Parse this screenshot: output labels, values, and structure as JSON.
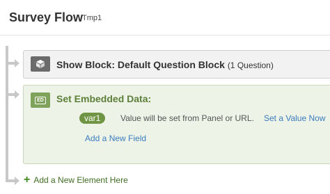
{
  "header": {
    "title": "Survey Flow",
    "subtitle": "Tmp1"
  },
  "flow": {
    "show_block": {
      "label": "Show Block: Default Question Block",
      "count": "(1 Question)"
    },
    "embedded_data": {
      "label": "Set Embedded Data:",
      "icon_tag": "ED",
      "field_name": "var1",
      "field_description": "Value will be set from Panel or URL.",
      "set_value_link": "Set a Value Now",
      "add_field_link": "Add a New Field"
    },
    "add_element": "Add a New Element Here"
  },
  "colors": {
    "accent_green": "#6f9444",
    "link_blue": "#3b7cc0",
    "embed_bg": "#edf3e6"
  }
}
